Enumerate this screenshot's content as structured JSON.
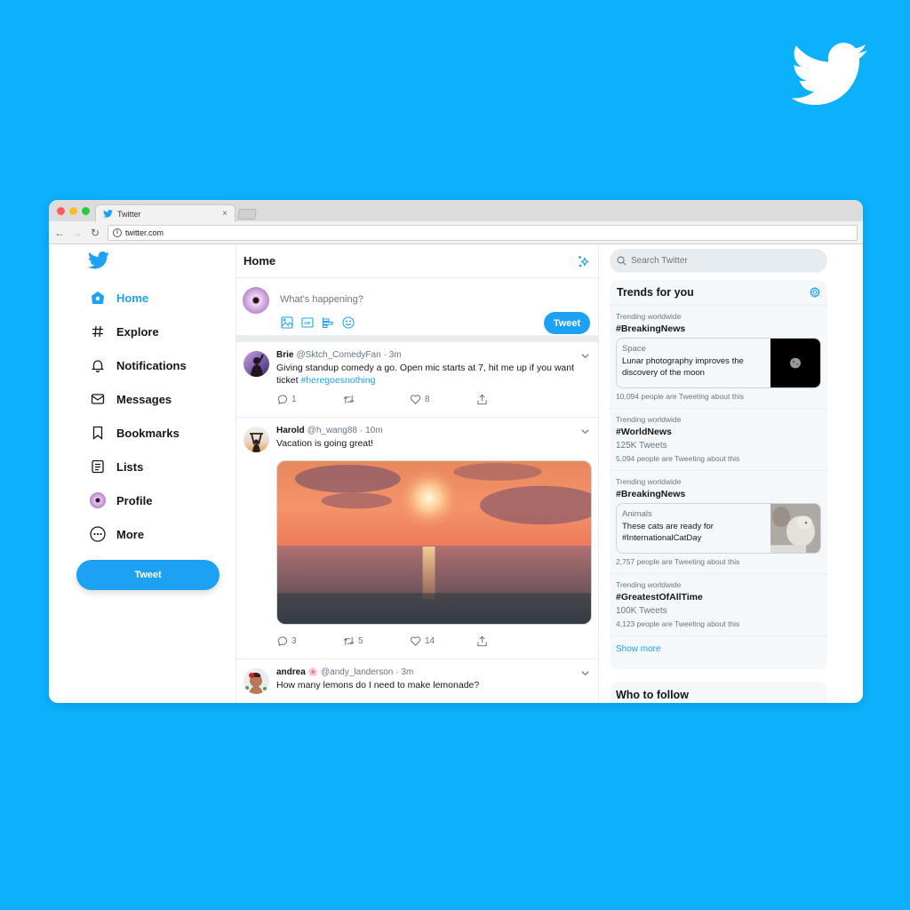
{
  "colors": {
    "background": "#0cb0fb",
    "accent": "#1da1f2",
    "text": "#14171a",
    "muted": "#657786"
  },
  "browser": {
    "tab_title": "Twitter",
    "tab_close": "×",
    "url": "twitter.com",
    "back_icon": "←",
    "forward_icon": "→",
    "reload_icon": "↻",
    "info_icon": "i"
  },
  "nav": {
    "items": [
      {
        "label": "Home",
        "icon": "home-icon",
        "active": true
      },
      {
        "label": "Explore",
        "icon": "hashtag-icon"
      },
      {
        "label": "Notifications",
        "icon": "bell-icon"
      },
      {
        "label": "Messages",
        "icon": "envelope-icon"
      },
      {
        "label": "Bookmarks",
        "icon": "bookmark-icon"
      },
      {
        "label": "Lists",
        "icon": "list-icon"
      },
      {
        "label": "Profile",
        "icon": "avatar-icon"
      },
      {
        "label": "More",
        "icon": "more-icon"
      }
    ],
    "tweet_button": "Tweet"
  },
  "feed": {
    "title": "Home",
    "composer": {
      "placeholder": "What's happening?",
      "tweet_button": "Tweet"
    },
    "tweets": [
      {
        "name": "Brie",
        "handle": "@Sktch_ComedyFan",
        "time": "· 3m",
        "text": "Giving standup comedy a go. Open mic starts at 7, hit me up if you want ticket ",
        "hashtag": "#heregoesnothing",
        "replies": "1",
        "retweets": "",
        "likes": "8"
      },
      {
        "name": "Harold",
        "handle": "@h_wang88",
        "time": "· 10m",
        "text": "Vacation is going great!",
        "replies": "3",
        "retweets": "5",
        "likes": "14"
      },
      {
        "name": "andrea",
        "emoji": "🌸",
        "handle": "@andy_landerson",
        "time": "· 3m",
        "text": "How many lemons do I need to make lemonade?"
      }
    ]
  },
  "sidebar": {
    "search_placeholder": "Search Twitter",
    "trends_title": "Trends for you",
    "trends": [
      {
        "label": "Trending worldwide",
        "tag": "#BreakingNews",
        "card": {
          "category": "Space",
          "text": "Lunar photography improves the discovery of the moon"
        },
        "sub": "10,094 people are Tweeting about this"
      },
      {
        "label": "Trending worldwide",
        "tag": "#WorldNews",
        "count": "125K Tweets",
        "sub": "5,094 people are Tweeting about this"
      },
      {
        "label": "Trending worldwide",
        "tag": "#BreakingNews",
        "card": {
          "category": "Animals",
          "text": "These cats are ready for #InternationalCatDay"
        },
        "sub": "2,757 people are Tweeting about this"
      },
      {
        "label": "Trending worldwide",
        "tag": "#GreatestOfAllTime",
        "count": "100K Tweets",
        "sub": "4,123 people are Tweeting about this"
      }
    ],
    "show_more": "Show more",
    "who_to_follow": "Who to follow"
  }
}
